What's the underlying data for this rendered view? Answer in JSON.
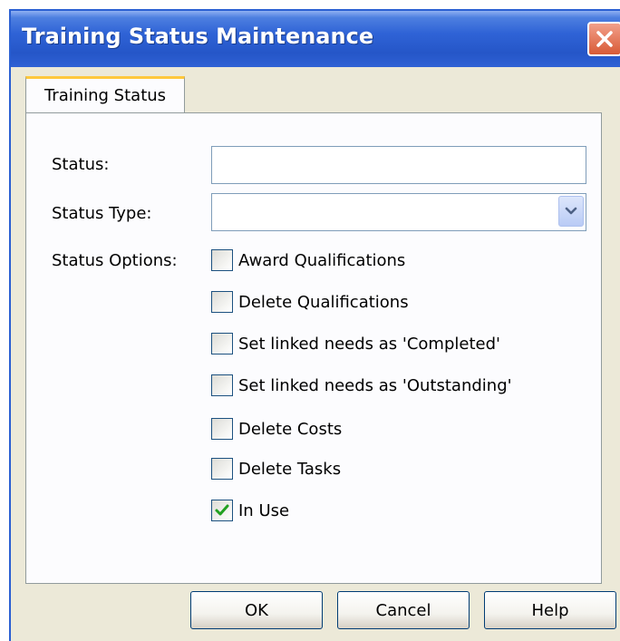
{
  "window": {
    "title": "Training Status Maintenance",
    "close_icon": "close-icon"
  },
  "tabs": [
    {
      "label": "Training Status",
      "active": true
    }
  ],
  "form": {
    "status_label": "Status:",
    "status_value": "",
    "status_type_label": "Status Type:",
    "status_type_value": "",
    "status_options_label": "Status Options:",
    "options": [
      {
        "label": "Award Qualifications",
        "checked": false
      },
      {
        "label": "Delete Qualifications",
        "checked": false
      },
      {
        "label": "Set linked needs as 'Completed'",
        "checked": false
      },
      {
        "label": "Set linked needs as 'Outstanding'",
        "checked": false
      },
      {
        "label": "Delete Costs",
        "checked": false
      },
      {
        "label": "Delete Tasks",
        "checked": false
      },
      {
        "label": "In Use",
        "checked": true
      }
    ]
  },
  "buttons": {
    "ok_label": "OK",
    "cancel_label": "Cancel",
    "help_label": "Help"
  },
  "colors": {
    "titlebar": "#2556c8",
    "tab_accent": "#ffc83c",
    "check_mark": "#21a121",
    "window_bg": "#ece9d8"
  }
}
